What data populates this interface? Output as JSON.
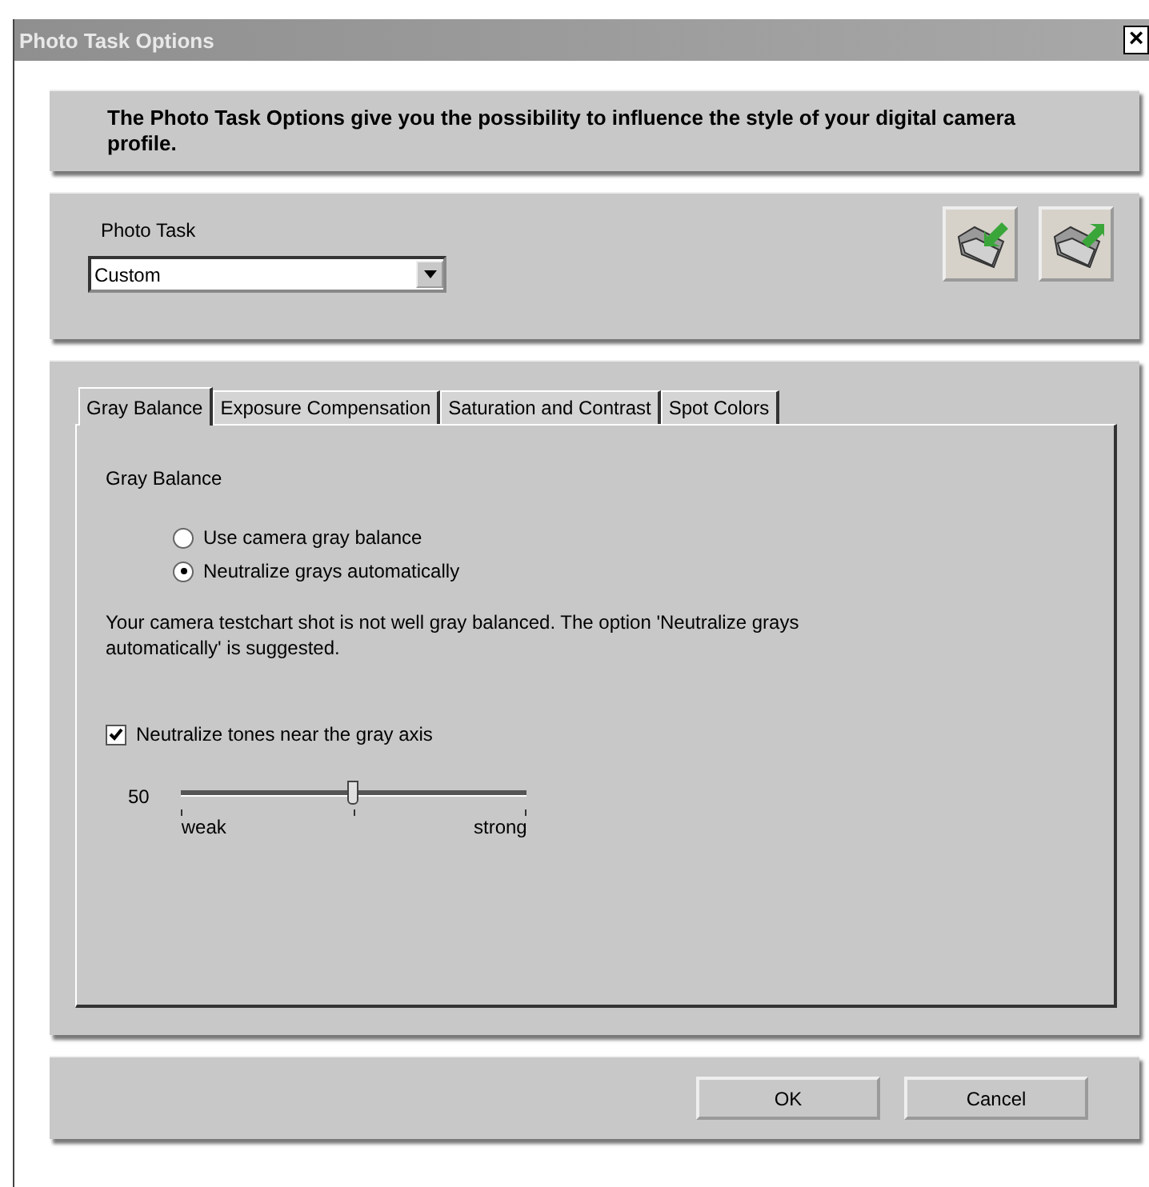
{
  "window": {
    "title": "Photo Task Options",
    "close": "×"
  },
  "intro": "The Photo Task Options give you the possibility to influence the style of your digital camera profile.",
  "photo_task": {
    "label": "Photo Task",
    "value": "Custom"
  },
  "tabs": [
    {
      "label": "Gray Balance",
      "selected": true
    },
    {
      "label": "Exposure Compensation",
      "selected": false
    },
    {
      "label": "Saturation and Contrast",
      "selected": false
    },
    {
      "label": "Spot Colors",
      "selected": false
    }
  ],
  "section_title": "Gray Balance",
  "options": [
    {
      "label": "Use camera gray balance",
      "selected": false
    },
    {
      "label": "Neutralize grays automatically",
      "selected": true
    }
  ],
  "message": "Your camera testchart shot is not well gray balanced. The option 'Neutralize grays automatically' is suggested.",
  "neutralize_tones": {
    "label": "Neutralize tones near the gray axis",
    "checked": true
  },
  "slider": {
    "reading": "50",
    "level": 0.5,
    "min_label": "weak",
    "max_label": "strong"
  },
  "buttons": [
    "OK",
    "Cancel"
  ]
}
